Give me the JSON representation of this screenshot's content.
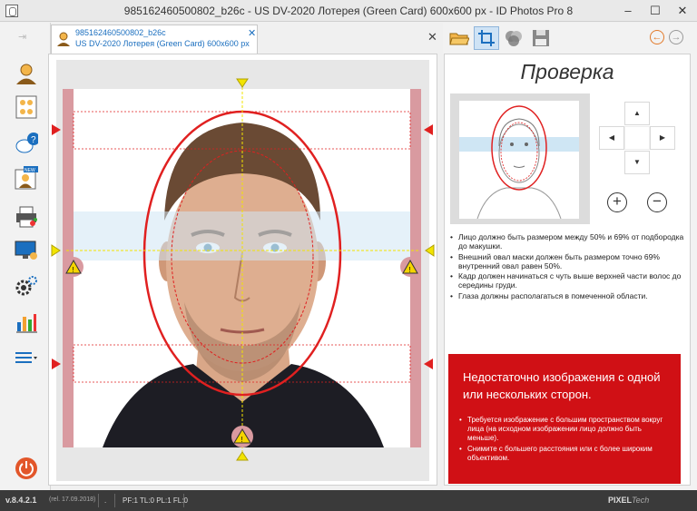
{
  "window": {
    "title": "985162460500802_b26c - US DV-2020 Лотерея (Green Card) 600x600 px - ID Photos Pro 8",
    "minimize": "–",
    "maximize": "☐",
    "close": "✕"
  },
  "sidebar": {
    "items": [
      {
        "icon": "person-icon"
      },
      {
        "icon": "photo-sheet-icon"
      },
      {
        "icon": "help-chat-icon"
      },
      {
        "icon": "new-template-icon",
        "badge": "NEW"
      },
      {
        "icon": "printer-icon"
      },
      {
        "icon": "monitor-icon"
      },
      {
        "icon": "settings-icon"
      },
      {
        "icon": "stats-icon"
      },
      {
        "icon": "menu-icon"
      },
      {
        "icon": "power-icon"
      }
    ]
  },
  "tab": {
    "line1": "985162460500802_b26c",
    "line2": "US DV-2020 Лотерея (Green Card) 600x600 px",
    "close": "✕"
  },
  "tabstrip_close": "✕",
  "toolbar": {
    "tools": [
      "folder-open-icon",
      "crop-icon",
      "effects-icon",
      "save-icon"
    ],
    "back": "←",
    "forward": "→"
  },
  "check": {
    "heading": "Проверка",
    "rules": [
      "Лицо должно быть размером между 50% и 69% от подбородка до макушки.",
      "Внешний овал маски должен быть размером точно 69% внутренний овал равен 50%.",
      "Кадр должен начинаться с чуть выше верхней части волос до середины груди.",
      "Глаза должны располагаться в помеченной области."
    ],
    "zoom_in": "+",
    "zoom_out": "−",
    "dpad": {
      "up": "▲",
      "left": "◀",
      "right": "▶",
      "down": "▼"
    }
  },
  "warning": {
    "heading": "Недостаточно изображения с одной или нескольких сторон.",
    "items": [
      "Требуется изображение с большим пространством вокруг лица (на исходном изображении лицо должно быть меньше).",
      "Снимите с большего расстояния или с более широким объективом."
    ]
  },
  "status": {
    "version": "v.8.4.2.1",
    "release": "(rel. 17.09.2018)",
    "dot": ".",
    "info": "PF:1 TL:0 PL:1 FL:0",
    "brand_a": "PIXEL",
    "brand_b": "Tech"
  },
  "colors": {
    "accent": "#1b6fbf",
    "warning_bg": "#d01015",
    "guide_red": "#e02020",
    "guide_yellow": "#f2e400",
    "eye_band": "#cfe6f4"
  }
}
